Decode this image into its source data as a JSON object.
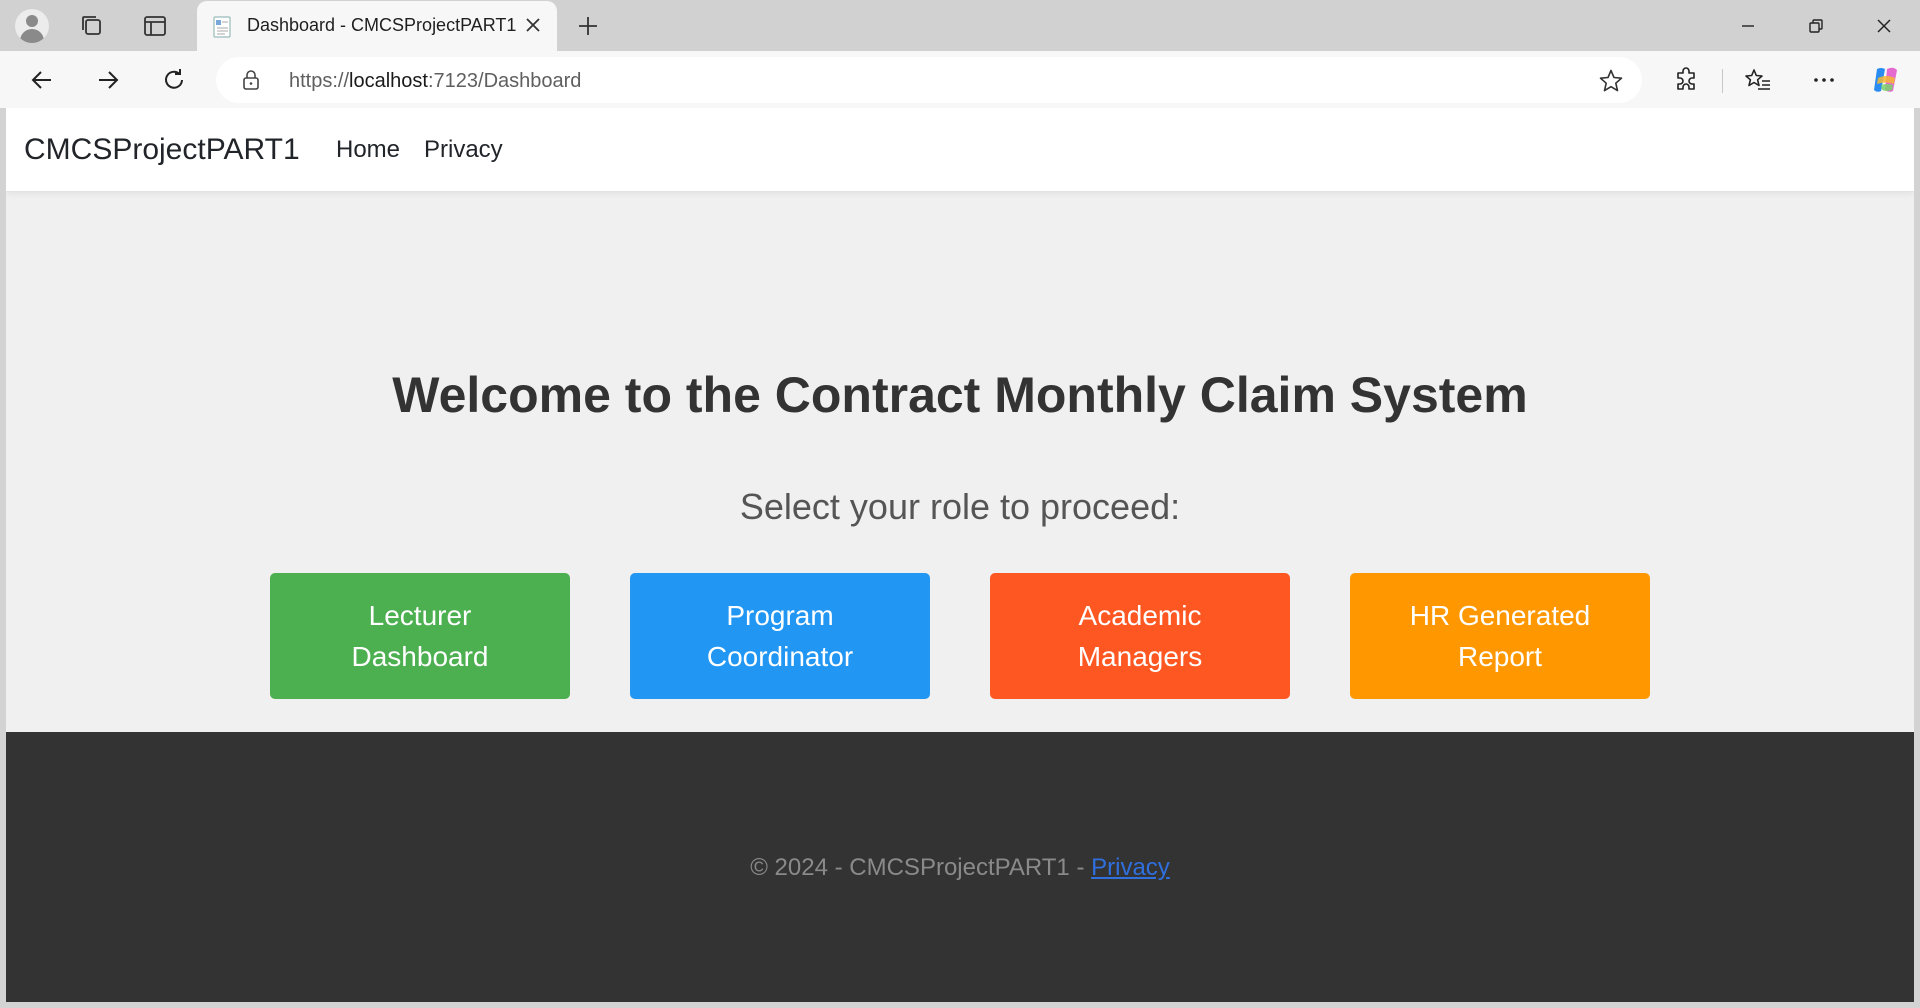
{
  "browser": {
    "tab": {
      "title": "Dashboard - CMCSProjectPART1"
    },
    "address": {
      "scheme": "https://",
      "host": "localhost",
      "rest": ":7123/Dashboard"
    },
    "icons": {
      "profile": "profile-avatar-icon",
      "workspaces": "workspaces-icon",
      "tab_actions": "tab-actions-icon",
      "new_tab": "plus-icon",
      "back": "back-arrow-icon",
      "forward": "forward-arrow-icon",
      "refresh": "refresh-icon",
      "lock": "lock-icon",
      "favorite": "star-icon",
      "extensions": "extensions-icon",
      "favorites_bar": "favorites-icon",
      "more": "more-icon",
      "copilot": "copilot-icon",
      "minimize": "minimize-icon",
      "restore": "restore-icon",
      "close": "close-icon"
    }
  },
  "site": {
    "brand": "CMCSProjectPART1",
    "nav": [
      "Home",
      "Privacy"
    ]
  },
  "main": {
    "heading": "Welcome to the Contract Monthly Claim System",
    "subheading": "Select your role to proceed:",
    "roles": [
      {
        "label": "Lecturer Dashboard",
        "color": "#4caf50"
      },
      {
        "label": "Program Coordinator",
        "color": "#2196f3"
      },
      {
        "label": "Academic Managers",
        "color": "#ff5722"
      },
      {
        "label": "HR Generated Report",
        "color": "#ff9800"
      }
    ]
  },
  "footer": {
    "text": "© 2024 - CMCSProjectPART1 - ",
    "link": "Privacy"
  }
}
